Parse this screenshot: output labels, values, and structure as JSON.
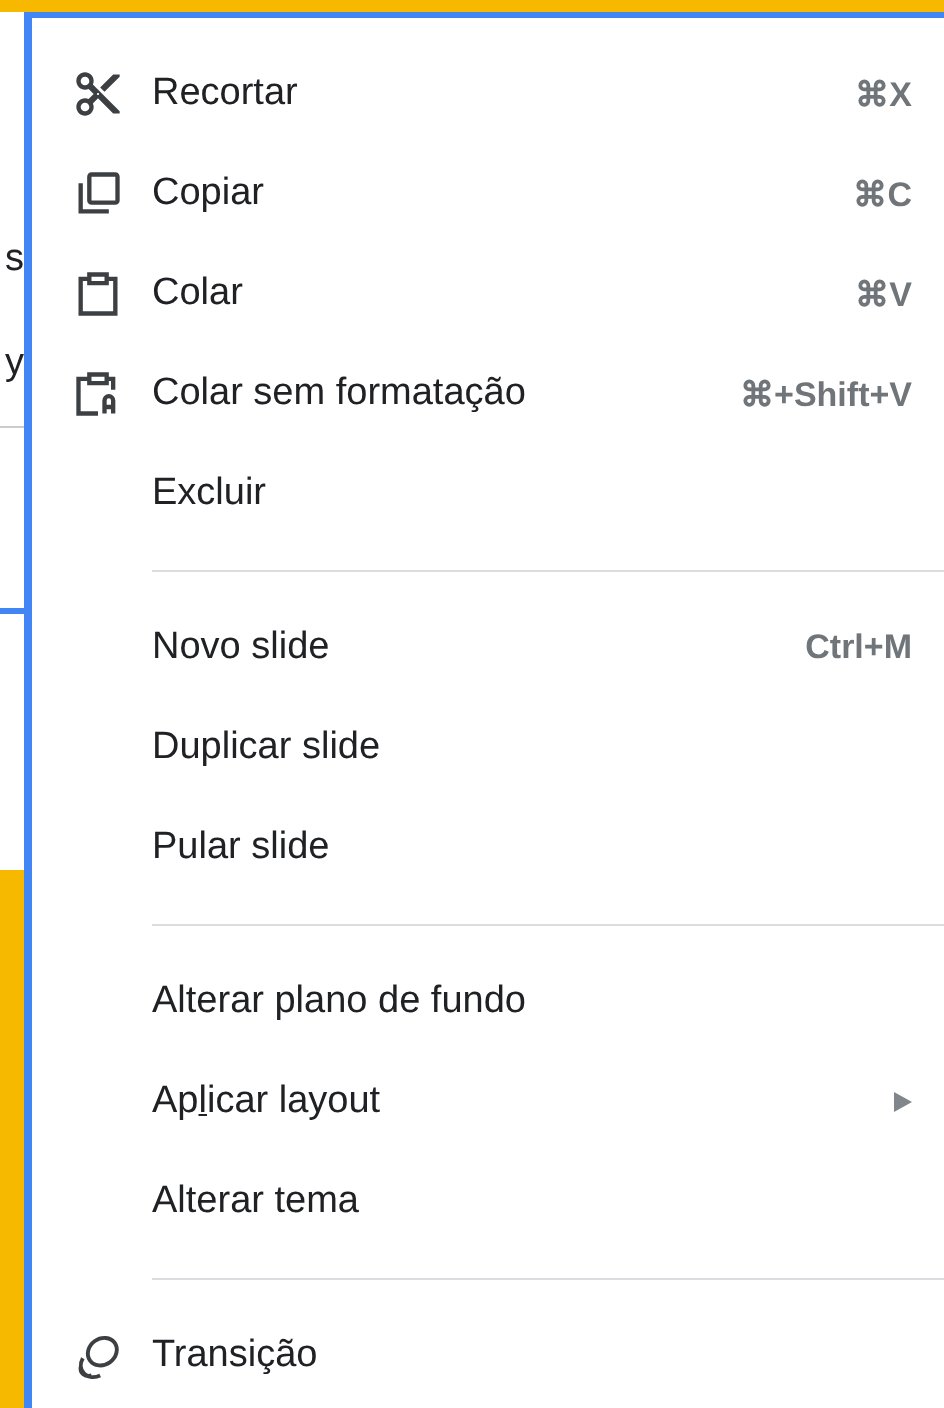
{
  "background": {
    "fragments": [
      "s",
      "y"
    ]
  },
  "menu": {
    "sections": [
      {
        "items": [
          {
            "label": "Recortar",
            "shortcut": "⌘X"
          },
          {
            "label": "Copiar",
            "shortcut": "⌘C"
          },
          {
            "label": "Colar",
            "shortcut": "⌘V"
          },
          {
            "label": "Colar sem formatação",
            "shortcut": "⌘+Shift+V"
          },
          {
            "label": "Excluir"
          }
        ]
      },
      {
        "items": [
          {
            "label": "Novo slide",
            "shortcut": "Ctrl+M"
          },
          {
            "label": "Duplicar slide"
          },
          {
            "label": "Pular slide"
          }
        ]
      },
      {
        "items": [
          {
            "label": "Alterar plano de fundo"
          },
          {
            "label_parts": [
              "Ap",
              "l",
              "icar layout"
            ],
            "submenu": true
          },
          {
            "label": "Alterar tema"
          }
        ]
      },
      {
        "items": [
          {
            "label": "Transição"
          }
        ]
      }
    ]
  }
}
